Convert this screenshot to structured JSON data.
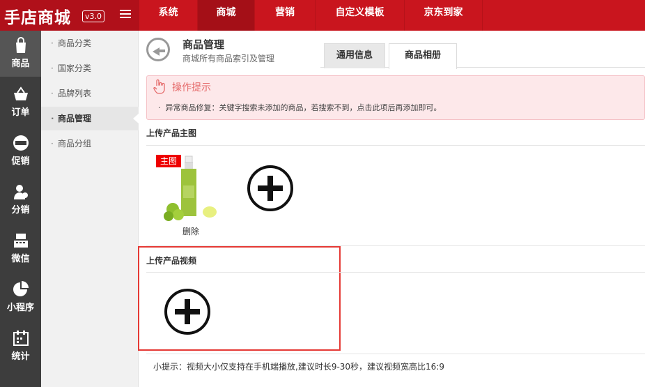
{
  "app": {
    "logo": "手店商城",
    "version": "v3.0"
  },
  "topnav": [
    {
      "label": "系统",
      "active": false
    },
    {
      "label": "商城",
      "active": true
    },
    {
      "label": "营销",
      "active": false
    },
    {
      "label": "自定义模板",
      "active": false
    },
    {
      "label": "京东到家",
      "active": false
    }
  ],
  "sidebar": [
    {
      "label": "商品",
      "icon": "shopping-bag-icon",
      "active": true
    },
    {
      "label": "订单",
      "icon": "basket-icon",
      "active": false
    },
    {
      "label": "促销",
      "icon": "sale-badge-icon",
      "active": false
    },
    {
      "label": "分销",
      "icon": "users-icon",
      "active": false
    },
    {
      "label": "微信",
      "icon": "register-icon",
      "active": false
    },
    {
      "label": "小程序",
      "icon": "pie-chart-icon",
      "active": false
    },
    {
      "label": "统计",
      "icon": "calendar-icon",
      "active": false
    }
  ],
  "subnav": [
    {
      "label": "商品分类",
      "active": false
    },
    {
      "label": "国家分类",
      "active": false
    },
    {
      "label": "品牌列表",
      "active": false
    },
    {
      "label": "商品管理",
      "active": true
    },
    {
      "label": "商品分组",
      "active": false
    }
  ],
  "page": {
    "title": "商品管理",
    "subtitle": "商城所有商品索引及管理",
    "tabs": [
      {
        "label": "通用信息",
        "active": false
      },
      {
        "label": "商品相册",
        "active": true
      }
    ]
  },
  "notice": {
    "title": "操作提示",
    "text": "异常商品修复：关键字搜索未添加的商品，若搜索不到，点击此项后再添加即可。"
  },
  "main_image": {
    "section_title": "上传产品主图",
    "tag": "主图",
    "delete_label": "删除"
  },
  "video": {
    "section_title": "上传产品视频",
    "tip": "小提示：视频大小仅支持在手机端播放,建议时长9-30秒，建议视频宽高比16:9"
  },
  "colors": {
    "brand_red": "#c9151e",
    "sidebar_dark": "#3d3d3d",
    "highlight_box": "#e53935"
  }
}
